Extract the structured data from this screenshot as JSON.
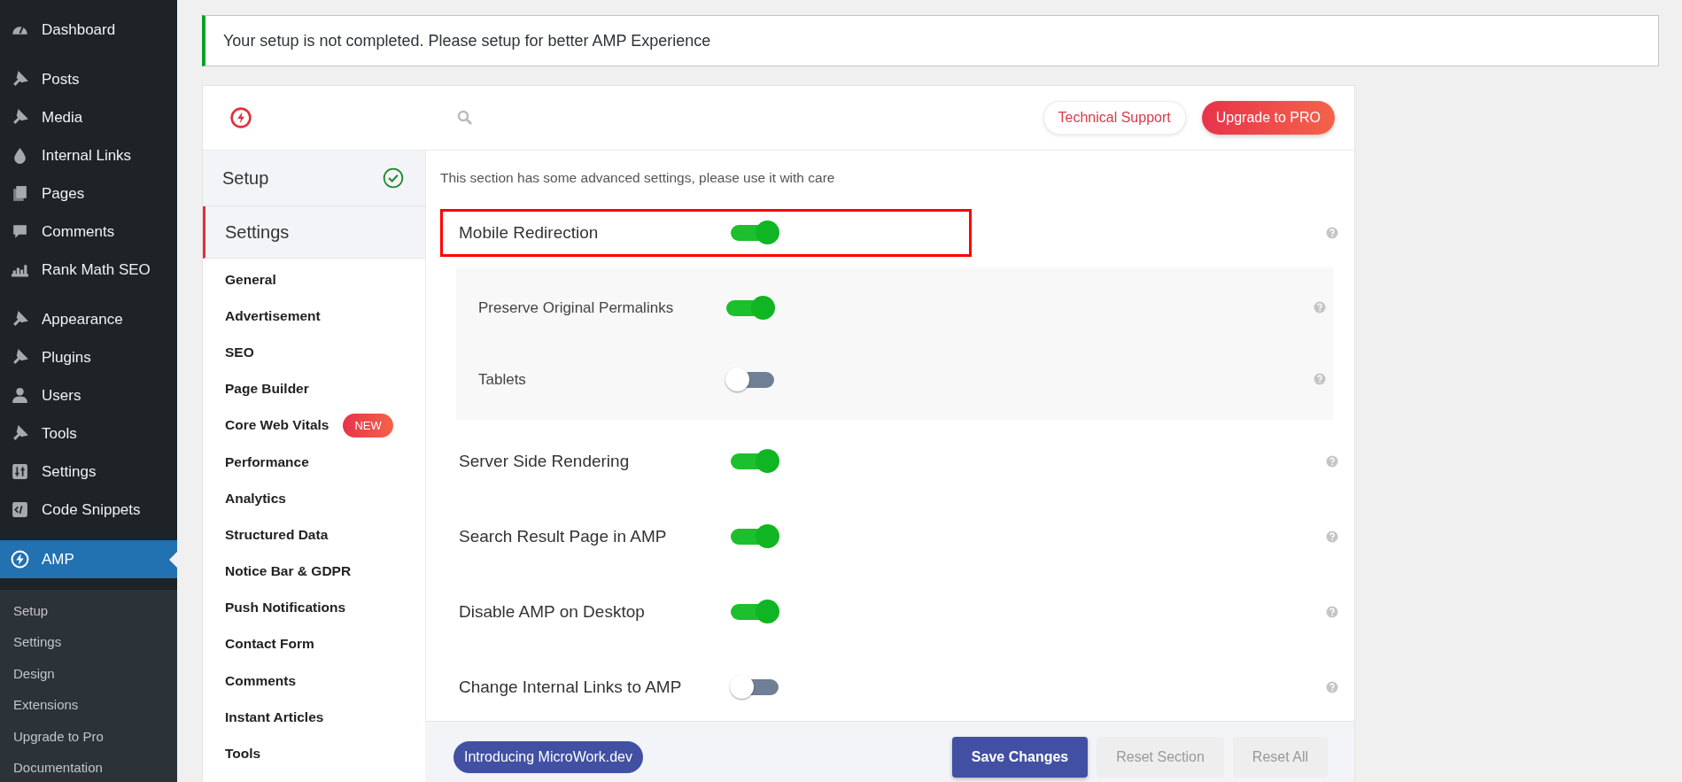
{
  "wp_menu": {
    "groups": [
      [
        {
          "label": "Dashboard",
          "selected": false
        }
      ],
      [
        {
          "label": "Posts",
          "selected": false
        },
        {
          "label": "Media",
          "selected": false
        },
        {
          "label": "Internal Links",
          "selected": false
        },
        {
          "label": "Pages",
          "selected": false
        },
        {
          "label": "Comments",
          "selected": false
        },
        {
          "label": "Rank Math SEO",
          "selected": false
        }
      ],
      [
        {
          "label": "Appearance",
          "selected": false
        },
        {
          "label": "Plugins",
          "selected": false
        },
        {
          "label": "Users",
          "selected": false
        },
        {
          "label": "Tools",
          "selected": false
        },
        {
          "label": "Settings",
          "selected": false
        },
        {
          "label": "Code Snippets",
          "selected": false
        }
      ],
      [
        {
          "label": "AMP",
          "selected": true
        }
      ]
    ],
    "submenu": [
      "Setup",
      "Settings",
      "Design",
      "Extensions",
      "Upgrade to Pro",
      "Documentation"
    ]
  },
  "notice": "Your setup is not completed. Please setup for better AMP Experience",
  "header": {
    "buttons": [
      {
        "label": "Technical Support",
        "kind": "outline"
      },
      {
        "label": "Upgrade to PRO",
        "kind": "gradient"
      }
    ]
  },
  "nav": {
    "sections": [
      {
        "label": "Setup",
        "completed": true,
        "selected": false
      },
      {
        "label": "Settings",
        "completed": false,
        "selected": true
      }
    ],
    "items": [
      {
        "label": "General"
      },
      {
        "label": "Advertisement"
      },
      {
        "label": "SEO"
      },
      {
        "label": "Page Builder"
      },
      {
        "label": "Core Web Vitals",
        "badge": "NEW"
      },
      {
        "label": "Performance"
      },
      {
        "label": "Analytics"
      },
      {
        "label": "Structured Data"
      },
      {
        "label": "Notice Bar & GDPR"
      },
      {
        "label": "Push Notifications"
      },
      {
        "label": "Contact Form"
      },
      {
        "label": "Comments"
      },
      {
        "label": "Instant Articles"
      },
      {
        "label": "Tools"
      }
    ]
  },
  "intro": "This section has some advanced settings, please use it with care",
  "settings": [
    {
      "label": "Mobile Redirection",
      "on": true,
      "highlighted": true,
      "children": [
        {
          "label": "Preserve Original Permalinks",
          "on": true
        },
        {
          "label": "Tablets",
          "on": false
        }
      ]
    },
    {
      "label": "Server Side Rendering",
      "on": true,
      "highlighted": false
    },
    {
      "label": "Search Result Page in AMP",
      "on": true,
      "highlighted": false
    },
    {
      "label": "Disable AMP on Desktop",
      "on": true,
      "highlighted": false
    },
    {
      "label": "Change Internal Links to AMP",
      "on": false,
      "highlighted": false
    }
  ],
  "footer": {
    "promo": "Introducing MicroWork.dev",
    "buttons": [
      {
        "label": "Save Changes",
        "kind": "primary"
      },
      {
        "label": "Reset Section",
        "kind": "muted"
      },
      {
        "label": "Reset All",
        "kind": "muted"
      }
    ]
  }
}
